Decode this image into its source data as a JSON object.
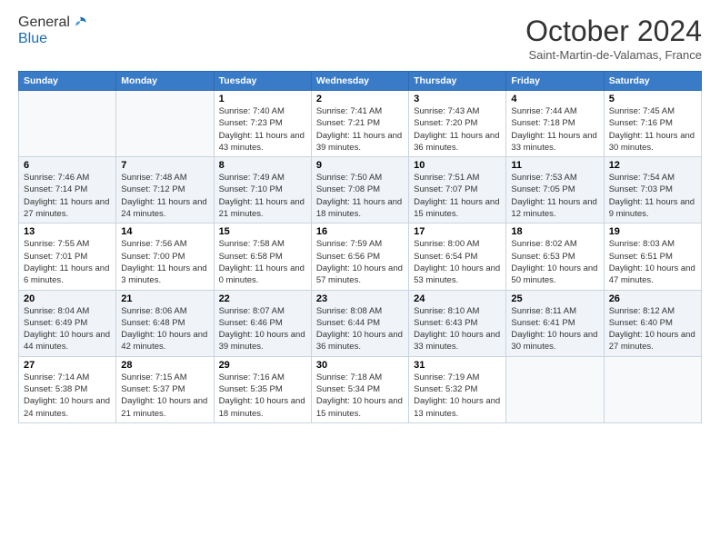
{
  "logo": {
    "general": "General",
    "blue": "Blue"
  },
  "header": {
    "month": "October 2024",
    "location": "Saint-Martin-de-Valamas, France"
  },
  "weekdays": [
    "Sunday",
    "Monday",
    "Tuesday",
    "Wednesday",
    "Thursday",
    "Friday",
    "Saturday"
  ],
  "weeks": [
    [
      {
        "day": "",
        "sunrise": "",
        "sunset": "",
        "daylight": ""
      },
      {
        "day": "",
        "sunrise": "",
        "sunset": "",
        "daylight": ""
      },
      {
        "day": "1",
        "sunrise": "Sunrise: 7:40 AM",
        "sunset": "Sunset: 7:23 PM",
        "daylight": "Daylight: 11 hours and 43 minutes."
      },
      {
        "day": "2",
        "sunrise": "Sunrise: 7:41 AM",
        "sunset": "Sunset: 7:21 PM",
        "daylight": "Daylight: 11 hours and 39 minutes."
      },
      {
        "day": "3",
        "sunrise": "Sunrise: 7:43 AM",
        "sunset": "Sunset: 7:20 PM",
        "daylight": "Daylight: 11 hours and 36 minutes."
      },
      {
        "day": "4",
        "sunrise": "Sunrise: 7:44 AM",
        "sunset": "Sunset: 7:18 PM",
        "daylight": "Daylight: 11 hours and 33 minutes."
      },
      {
        "day": "5",
        "sunrise": "Sunrise: 7:45 AM",
        "sunset": "Sunset: 7:16 PM",
        "daylight": "Daylight: 11 hours and 30 minutes."
      }
    ],
    [
      {
        "day": "6",
        "sunrise": "Sunrise: 7:46 AM",
        "sunset": "Sunset: 7:14 PM",
        "daylight": "Daylight: 11 hours and 27 minutes."
      },
      {
        "day": "7",
        "sunrise": "Sunrise: 7:48 AM",
        "sunset": "Sunset: 7:12 PM",
        "daylight": "Daylight: 11 hours and 24 minutes."
      },
      {
        "day": "8",
        "sunrise": "Sunrise: 7:49 AM",
        "sunset": "Sunset: 7:10 PM",
        "daylight": "Daylight: 11 hours and 21 minutes."
      },
      {
        "day": "9",
        "sunrise": "Sunrise: 7:50 AM",
        "sunset": "Sunset: 7:08 PM",
        "daylight": "Daylight: 11 hours and 18 minutes."
      },
      {
        "day": "10",
        "sunrise": "Sunrise: 7:51 AM",
        "sunset": "Sunset: 7:07 PM",
        "daylight": "Daylight: 11 hours and 15 minutes."
      },
      {
        "day": "11",
        "sunrise": "Sunrise: 7:53 AM",
        "sunset": "Sunset: 7:05 PM",
        "daylight": "Daylight: 11 hours and 12 minutes."
      },
      {
        "day": "12",
        "sunrise": "Sunrise: 7:54 AM",
        "sunset": "Sunset: 7:03 PM",
        "daylight": "Daylight: 11 hours and 9 minutes."
      }
    ],
    [
      {
        "day": "13",
        "sunrise": "Sunrise: 7:55 AM",
        "sunset": "Sunset: 7:01 PM",
        "daylight": "Daylight: 11 hours and 6 minutes."
      },
      {
        "day": "14",
        "sunrise": "Sunrise: 7:56 AM",
        "sunset": "Sunset: 7:00 PM",
        "daylight": "Daylight: 11 hours and 3 minutes."
      },
      {
        "day": "15",
        "sunrise": "Sunrise: 7:58 AM",
        "sunset": "Sunset: 6:58 PM",
        "daylight": "Daylight: 11 hours and 0 minutes."
      },
      {
        "day": "16",
        "sunrise": "Sunrise: 7:59 AM",
        "sunset": "Sunset: 6:56 PM",
        "daylight": "Daylight: 10 hours and 57 minutes."
      },
      {
        "day": "17",
        "sunrise": "Sunrise: 8:00 AM",
        "sunset": "Sunset: 6:54 PM",
        "daylight": "Daylight: 10 hours and 53 minutes."
      },
      {
        "day": "18",
        "sunrise": "Sunrise: 8:02 AM",
        "sunset": "Sunset: 6:53 PM",
        "daylight": "Daylight: 10 hours and 50 minutes."
      },
      {
        "day": "19",
        "sunrise": "Sunrise: 8:03 AM",
        "sunset": "Sunset: 6:51 PM",
        "daylight": "Daylight: 10 hours and 47 minutes."
      }
    ],
    [
      {
        "day": "20",
        "sunrise": "Sunrise: 8:04 AM",
        "sunset": "Sunset: 6:49 PM",
        "daylight": "Daylight: 10 hours and 44 minutes."
      },
      {
        "day": "21",
        "sunrise": "Sunrise: 8:06 AM",
        "sunset": "Sunset: 6:48 PM",
        "daylight": "Daylight: 10 hours and 42 minutes."
      },
      {
        "day": "22",
        "sunrise": "Sunrise: 8:07 AM",
        "sunset": "Sunset: 6:46 PM",
        "daylight": "Daylight: 10 hours and 39 minutes."
      },
      {
        "day": "23",
        "sunrise": "Sunrise: 8:08 AM",
        "sunset": "Sunset: 6:44 PM",
        "daylight": "Daylight: 10 hours and 36 minutes."
      },
      {
        "day": "24",
        "sunrise": "Sunrise: 8:10 AM",
        "sunset": "Sunset: 6:43 PM",
        "daylight": "Daylight: 10 hours and 33 minutes."
      },
      {
        "day": "25",
        "sunrise": "Sunrise: 8:11 AM",
        "sunset": "Sunset: 6:41 PM",
        "daylight": "Daylight: 10 hours and 30 minutes."
      },
      {
        "day": "26",
        "sunrise": "Sunrise: 8:12 AM",
        "sunset": "Sunset: 6:40 PM",
        "daylight": "Daylight: 10 hours and 27 minutes."
      }
    ],
    [
      {
        "day": "27",
        "sunrise": "Sunrise: 7:14 AM",
        "sunset": "Sunset: 5:38 PM",
        "daylight": "Daylight: 10 hours and 24 minutes."
      },
      {
        "day": "28",
        "sunrise": "Sunrise: 7:15 AM",
        "sunset": "Sunset: 5:37 PM",
        "daylight": "Daylight: 10 hours and 21 minutes."
      },
      {
        "day": "29",
        "sunrise": "Sunrise: 7:16 AM",
        "sunset": "Sunset: 5:35 PM",
        "daylight": "Daylight: 10 hours and 18 minutes."
      },
      {
        "day": "30",
        "sunrise": "Sunrise: 7:18 AM",
        "sunset": "Sunset: 5:34 PM",
        "daylight": "Daylight: 10 hours and 15 minutes."
      },
      {
        "day": "31",
        "sunrise": "Sunrise: 7:19 AM",
        "sunset": "Sunset: 5:32 PM",
        "daylight": "Daylight: 10 hours and 13 minutes."
      },
      {
        "day": "",
        "sunrise": "",
        "sunset": "",
        "daylight": ""
      },
      {
        "day": "",
        "sunrise": "",
        "sunset": "",
        "daylight": ""
      }
    ]
  ]
}
